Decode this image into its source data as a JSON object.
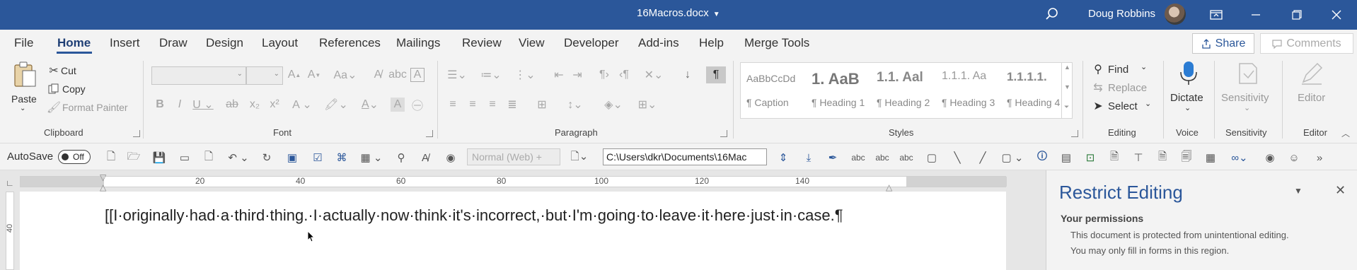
{
  "window": {
    "doc_title": "16Macros.docx",
    "user_name": "Doug Robbins"
  },
  "menu": {
    "tabs": [
      "File",
      "Home",
      "Insert",
      "Draw",
      "Design",
      "Layout",
      "References",
      "Mailings",
      "Review",
      "View",
      "Developer",
      "Add-ins",
      "Help",
      "Merge Tools"
    ],
    "active": "Home",
    "share_label": "Share",
    "comments_label": "Comments"
  },
  "ribbon": {
    "clipboard": {
      "paste": "Paste",
      "cut": "Cut",
      "copy": "Copy",
      "format_painter": "Format Painter",
      "label": "Clipboard"
    },
    "font": {
      "label": "Font"
    },
    "paragraph": {
      "label": "Paragraph"
    },
    "styles": {
      "label": "Styles",
      "items": [
        {
          "sample": "AaBbCcDd",
          "name": "¶ Caption"
        },
        {
          "sample": "1. AaB",
          "name": "¶ Heading 1"
        },
        {
          "sample": "1.1. Aal",
          "name": "¶ Heading 2"
        },
        {
          "sample": "1.1.1. Aa",
          "name": "¶ Heading 3"
        },
        {
          "sample": "1.1.1.1.",
          "name": "¶ Heading 4"
        }
      ]
    },
    "editing": {
      "find": "Find",
      "replace": "Replace",
      "select": "Select",
      "label": "Editing"
    },
    "voice": {
      "dictate": "Dictate",
      "label": "Voice"
    },
    "sensitivity": {
      "button": "Sensitivity",
      "label": "Sensitivity"
    },
    "editor": {
      "button": "Editor",
      "label": "Editor"
    }
  },
  "qat": {
    "autosave_label": "AutoSave",
    "autosave_state": "Off",
    "style_box": "Normal (Web) +",
    "path_box": "C:\\Users\\dkr\\Documents\\16Mac"
  },
  "ruler": {
    "labels": [
      "20",
      "40",
      "60",
      "80",
      "100",
      "120",
      "140"
    ],
    "vertical_label": "40"
  },
  "document": {
    "text": "[[I·originally·had·a·third·thing.·I·actually·now·think·it's·incorrect,·but·I'm·going·to·leave·it·here·just·in·case.¶"
  },
  "pane": {
    "title": "Restrict Editing",
    "subtitle": "Your permissions",
    "line1": "This document is protected from unintentional editing.",
    "line2": "You may only fill in forms in this region."
  }
}
